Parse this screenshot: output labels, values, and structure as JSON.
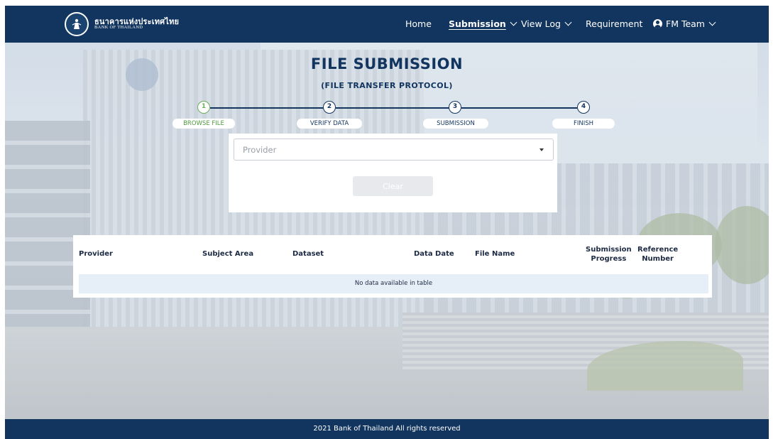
{
  "header": {
    "logo_th": "ธนาคารแห่งประเทศไทย",
    "logo_en": "BANK OF THAILAND",
    "nav": {
      "home": "Home",
      "submission": "Submission",
      "view_log": "View Log",
      "requirement": "Requirement",
      "user": "FM Team"
    }
  },
  "page": {
    "title": "FILE SUBMISSION",
    "subtitle": "(FILE TRANSFER PROTOCOL)"
  },
  "stepper": {
    "current_step": 1,
    "steps": [
      {
        "number": "1",
        "label": "BROWSE FILE"
      },
      {
        "number": "2",
        "label": "VERIFY DATA"
      },
      {
        "number": "3",
        "label": "SUBMISSION"
      },
      {
        "number": "4",
        "label": "FINISH"
      }
    ]
  },
  "form": {
    "provider_placeholder": "Provider",
    "clear_label": "Clear"
  },
  "table": {
    "columns": [
      "Provider",
      "Subject Area",
      "Dataset",
      "Data Date",
      "File Name",
      [
        "Submission",
        "Progress"
      ],
      [
        "Reference",
        "Number"
      ]
    ],
    "empty_message": "No data available in table"
  },
  "footer": {
    "text": "2021 Bank of Thailand All rights reserved"
  },
  "colors": {
    "navy": "#12355f",
    "step_done": "#6cae5d",
    "empty_row": "#e6eef7"
  }
}
